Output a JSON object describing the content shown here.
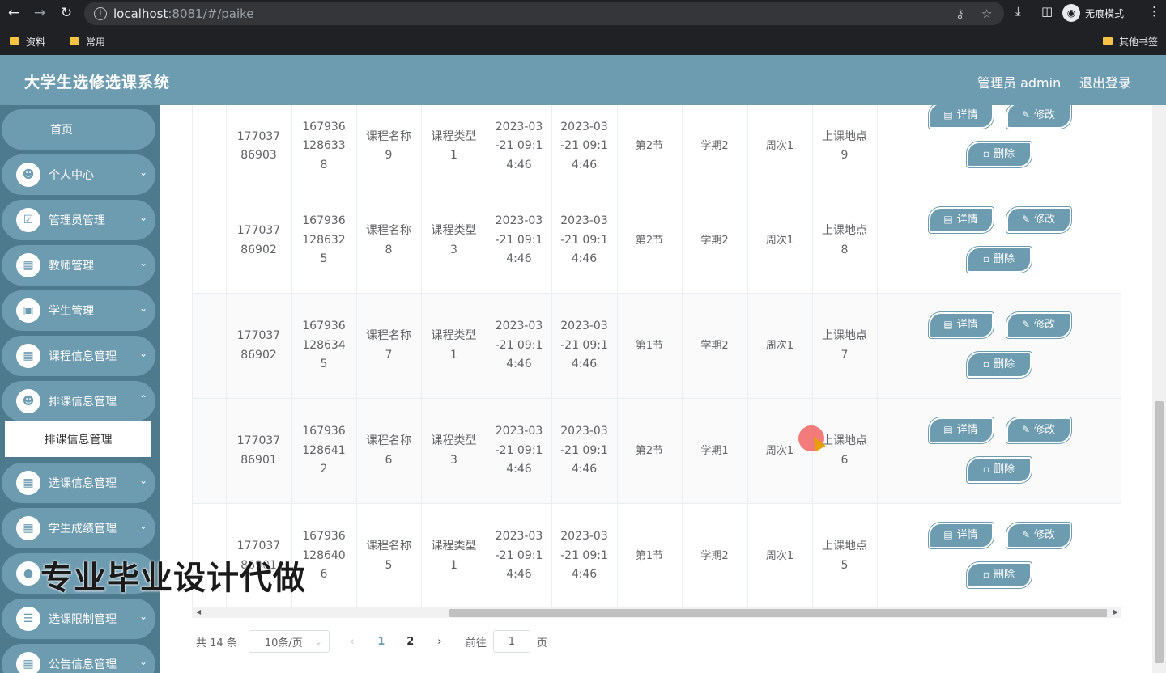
{
  "browser": {
    "url_host": "localhost",
    "url_rest": ":8081/#/paike",
    "incognito_label": "无痕模式",
    "bookmarks": [
      "资料",
      "常用"
    ],
    "other_bookmarks": "其他书签"
  },
  "app": {
    "title": "大学生选修选课系统",
    "admin_label": "管理员 admin",
    "logout_label": "退出登录"
  },
  "sidebar": {
    "home": "首页",
    "items": [
      {
        "label": "个人中心",
        "icon": "user-icon"
      },
      {
        "label": "管理员管理",
        "icon": "clipboard-icon"
      },
      {
        "label": "教师管理",
        "icon": "grid-icon"
      },
      {
        "label": "学生管理",
        "icon": "wallet-icon"
      },
      {
        "label": "课程信息管理",
        "icon": "grid-icon"
      },
      {
        "label": "排课信息管理",
        "icon": "user-icon"
      },
      {
        "label": "选课信息管理",
        "icon": "grid-icon"
      },
      {
        "label": "学生成绩管理",
        "icon": "grid-icon"
      },
      {
        "label": "",
        "icon": "bulb-icon"
      },
      {
        "label": "选课限制管理",
        "icon": "list-icon"
      },
      {
        "label": "公告信息管理",
        "icon": "grid-icon"
      }
    ],
    "active_sub": "排课信息管理"
  },
  "table": {
    "rows": [
      {
        "c1": "17703786903",
        "c2": "1679361286338",
        "c3": "课程名称9",
        "c4": "课程类型1",
        "c5": "2023-03-21 09:14:46",
        "c6": "2023-03-21 09:14:46",
        "c7": "第2节",
        "c8": "学期2",
        "c9": "周次1",
        "c10": "上课地点9"
      },
      {
        "c1": "17703786902",
        "c2": "1679361286325",
        "c3": "课程名称8",
        "c4": "课程类型3",
        "c5": "2023-03-21 09:14:46",
        "c6": "2023-03-21 09:14:46",
        "c7": "第2节",
        "c8": "学期2",
        "c9": "周次1",
        "c10": "上课地点8"
      },
      {
        "c1": "17703786902",
        "c2": "1679361286345",
        "c3": "课程名称7",
        "c4": "课程类型1",
        "c5": "2023-03-21 09:14:46",
        "c6": "2023-03-21 09:14:46",
        "c7": "第1节",
        "c8": "学期2",
        "c9": "周次1",
        "c10": "上课地点7"
      },
      {
        "c1": "17703786901",
        "c2": "1679361286412",
        "c3": "课程名称6",
        "c4": "课程类型3",
        "c5": "2023-03-21 09:14:46",
        "c6": "2023-03-21 09:14:46",
        "c7": "第2节",
        "c8": "学期1",
        "c9": "周次1",
        "c10": "上课地点6"
      },
      {
        "c1": "17703786901",
        "c2": "1679361286406",
        "c3": "课程名称5",
        "c4": "课程类型1",
        "c5": "2023-03-21 09:14:46",
        "c6": "2023-03-21 09:14:46",
        "c7": "第1节",
        "c8": "学期2",
        "c9": "周次1",
        "c10": "上课地点5"
      }
    ],
    "actions": {
      "detail": "详情",
      "edit": "修改",
      "delete": "删除"
    }
  },
  "pager": {
    "total": "共 14 条",
    "size": "10条/页",
    "pages": [
      "1",
      "2"
    ],
    "current": "1",
    "goto": "前往",
    "goto_value": "1",
    "page_unit": "页"
  },
  "watermark": "专业毕业设计代做",
  "colors": {
    "primary": "#6d9bb0",
    "sidebar": "#4d7a8d"
  }
}
